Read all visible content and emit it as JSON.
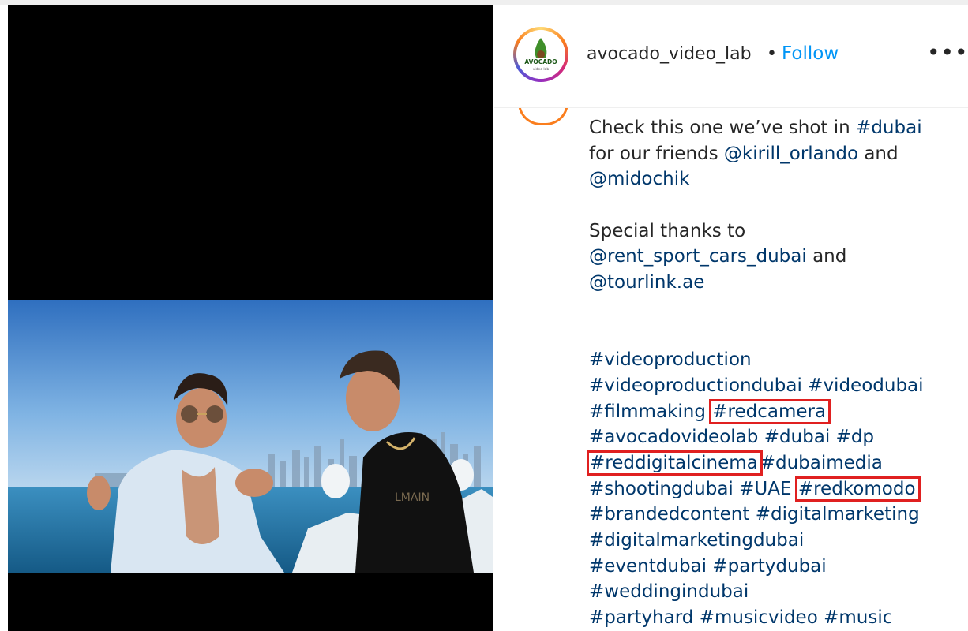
{
  "post": {
    "author": {
      "username": "avocado_video_lab",
      "separator": "•",
      "follow_label": "Follow",
      "more_label": "•••",
      "logo_text": "AVOCADO",
      "logo_subtext": "video lab"
    },
    "caption": {
      "intro": "Check this one we’ve shot in ",
      "tag_dubai": "#dubai",
      "friends_text": "for our friends ",
      "mention_kirill": "@kirill_orlando",
      "and_1": " and",
      "mention_midochik": "@midochik",
      "thanks_text": "Special thanks to",
      "mention_rent": "@rent_sport_cars_dubai",
      "and_2": " and",
      "mention_tourlink": "@tourlink.ae"
    },
    "hashtags": {
      "videoproduction": "#videoproduction",
      "videoproductiondubai": "#videoproductiondubai",
      "videodubai": "#videodubai",
      "filmmaking": "#filmmaking",
      "redcamera": "#redcamera",
      "avocadovideolab": "#avocadovideolab",
      "dubai": "#dubai",
      "dp": "#dp",
      "reddigitalcinema": "#reddigitalcinema",
      "dubaimedia": "#dubaimedia",
      "shootingdubai": "#shootingdubai",
      "uae": "#UAE",
      "redkomodo": "#redkomodo",
      "brandedcontent": "#brandedcontent",
      "digitalmarketing": "#digitalmarketing",
      "digitalmarketingdubai": "#digitalmarketingdubai",
      "eventdubai": "#eventdubai",
      "partydubai": "#partydubai",
      "weddingindubai": "#weddingindubai",
      "partyhard": "#partyhard",
      "musicvideo": "#musicvideo",
      "music": "#music"
    }
  },
  "colors": {
    "link": "#00376b",
    "follow": "#0095f6",
    "highlight_box": "#e02020",
    "text": "#262626"
  }
}
